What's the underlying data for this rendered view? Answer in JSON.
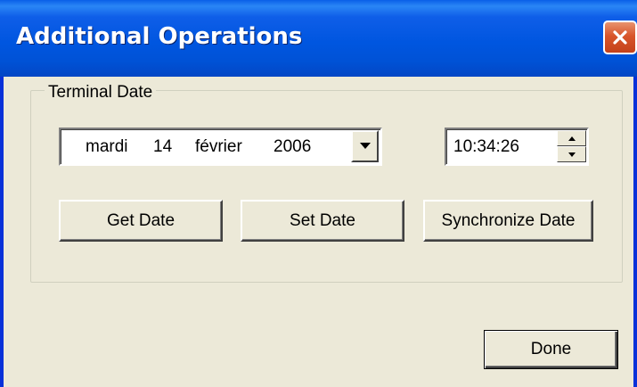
{
  "window": {
    "title": "Additional Operations",
    "close_icon": "close-icon"
  },
  "group": {
    "label": "Terminal Date"
  },
  "date_picker": {
    "weekday": "mardi",
    "day": "14",
    "month": "février",
    "year": "2006",
    "dropdown_icon": "chevron-down-icon"
  },
  "time_picker": {
    "value": "10:34:26",
    "up_icon": "spin-up-icon",
    "down_icon": "spin-down-icon"
  },
  "buttons": {
    "get_date": "Get Date",
    "set_date": "Set Date",
    "synchronize_date": "Synchronize Date",
    "done": "Done"
  },
  "colors": {
    "titlebar": "#0054e3",
    "face": "#ece9d8",
    "close": "#d8552b"
  }
}
